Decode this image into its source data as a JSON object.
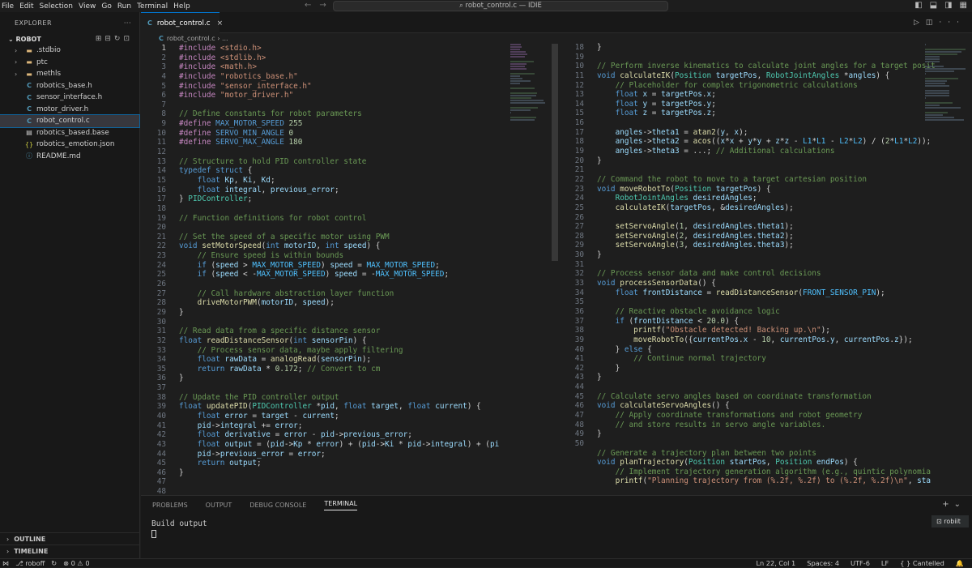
{
  "menu": [
    "File",
    "Edit",
    "Selection",
    "View",
    "Go",
    "Run",
    "Terminal",
    "Help"
  ],
  "command_center": "robot_control.c — IDIE",
  "sidebar": {
    "header": "EXPLORER",
    "root": "ROBOT",
    "items": [
      {
        "label": ".stdbio",
        "kind": "folder"
      },
      {
        "label": "ptc",
        "kind": "folder"
      },
      {
        "label": "methls",
        "kind": "folder"
      },
      {
        "label": "robotics_base.h",
        "kind": "c"
      },
      {
        "label": "sensor_interface.h",
        "kind": "c"
      },
      {
        "label": "motor_driver.h",
        "kind": "c"
      },
      {
        "label": "robot_control.c",
        "kind": "c",
        "selected": true
      },
      {
        "label": "robotics_based.base",
        "kind": "file"
      },
      {
        "label": "robotics_emotion.json",
        "kind": "json"
      },
      {
        "label": "README.md",
        "kind": "info"
      }
    ],
    "outline": "OUTLINE",
    "timeline": "TIMELINE"
  },
  "tab": {
    "label": "robot_control.c"
  },
  "breadcrumb": {
    "file": "robot_control.c",
    "more": "..."
  },
  "panel": {
    "tabs": [
      "PROBLEMS",
      "OUTPUT",
      "DEBUG CONSOLE",
      "TERMINAL"
    ],
    "active_tab": "TERMINAL",
    "output": "Build output",
    "terminal_name": "robiit"
  },
  "status": {
    "branch": "roboff",
    "problems": "0 ⚠ 0",
    "position": "Ln 22, Col 1",
    "spaces": "Spaces: 4",
    "encoding": "UTF-6",
    "eol": "LF",
    "status": "Cantelled"
  },
  "editor_left": {
    "start_line": 1,
    "current_line": 1,
    "lines": [
      "#include <stdio.h>",
      "#include <stdlib.h>",
      "#include <math.h>",
      "#include \"robotics_base.h\"",
      "#include \"sensor_interface.h\"",
      "#include \"motor_driver.h\"",
      "",
      "// Define constants for robot parameters",
      "#define MAX_MOTOR_SPEED 255",
      "#define SERVO_MIN_ANGLE 0",
      "#define SERVO_MAX_ANGLE 180",
      "",
      "// Structure to hold PID controller state",
      "typedef struct {",
      "    float Kp, Ki, Kd;",
      "    float integral, previous_error;",
      "} PIDController;",
      "",
      "// Function definitions for robot control",
      "",
      "// Set the speed of a specific motor using PWM",
      "void setMotorSpeed(int motorID, int speed) {",
      "    // Ensure speed is within bounds",
      "    if (speed > MAX_MOTOR_SPEED) speed = MAX_MOTOR_SPEED;",
      "    if (speed < -MAX_MOTOR_SPEED) speed = -MAX_MOTOR_SPEED;",
      "",
      "    // Call hardware abstraction layer function",
      "    driveMotorPWM(motorID, speed);",
      "}",
      "",
      "// Read data from a specific distance sensor",
      "float readDistanceSensor(int sensorPin) {",
      "    // Process sensor data, maybe apply filtering",
      "    float rawData = analogRead(sensorPin);",
      "    return rawData * 0.172; // Convert to cm",
      "}",
      "",
      "// Update the PID controller output",
      "float updatePID(PIDController *pid, float target, float current) {",
      "    float error = target - current;",
      "    pid->integral += error;",
      "    float derivative = error - pid->previous_error;",
      "    float output = (pid->Kp * error) + (pid->Ki * pid->integral) + (pi",
      "    pid->previous_error = error;",
      "    return output;",
      "}",
      "",
      ""
    ]
  },
  "editor_right": {
    "line_numbers": [
      "18",
      "19",
      "10",
      "11",
      "12",
      "13",
      "14",
      "15",
      "16",
      "17",
      "18",
      "19",
      "20",
      "21",
      "22",
      "23",
      "24",
      "25",
      "26",
      "27",
      "28",
      "29",
      "30",
      "31",
      "32",
      "33",
      "34",
      "35",
      "36",
      "37",
      "38",
      "39",
      "40",
      "41",
      "42",
      "43",
      "44",
      "45",
      "46",
      "47",
      "48",
      "49",
      "50"
    ],
    "lines": [
      "}",
      "",
      "// Perform inverse kinematics to calculate joint angles for a target posit",
      "void calculateIK(Position targetPos, RobotJointAngles *angles) {",
      "    // Placeholder for complex trigonometric calculations",
      "    float x = targetPos.x;",
      "    float y = targetPos.y;",
      "    float z = targetPos.z;",
      "",
      "    angles->theta1 = atan2(y, x);",
      "    angles->theta2 = acos((x*x + y*y + z*z - L1*L1 - L2*L2) / (2*L1*L2));",
      "    angles->theta3 = ...; // Additional calculations",
      "}",
      "",
      "// Command the robot to move to a target cartesian position",
      "void moveRobotTo(Position targetPos) {",
      "    RobotJointAngles desiredAngles;",
      "    calculateIK(targetPos, &desiredAngles);",
      "",
      "    setServoAngle(1, desiredAngles.theta1);",
      "    setServoAngle(2, desiredAngles.theta2);",
      "    setServoAngle(3, desiredAngles.theta3);",
      "}",
      "",
      "// Process sensor data and make control decisions",
      "void processSensorData() {",
      "    float frontDistance = readDistanceSensor(FRONT_SENSOR_PIN);",
      "",
      "    // Reactive obstacle avoidance logic",
      "    if (frontDistance < 20.0) {",
      "        printf(\"Obstacle detected! Backing up.\\n\");",
      "        moveRobotTo({currentPos.x - 10, currentPos.y, currentPos.z});",
      "    } else {",
      "        // Continue normal trajectory",
      "    }",
      "}",
      "",
      "// Calculate servo angles based on coordinate transformation",
      "void calculateServoAngles() {",
      "    // Apply coordinate transformations and robot geometry",
      "    // and store results in servo angle variables.",
      "}",
      "",
      "// Generate a trajectory plan between two points",
      "void planTrajectory(Position startPos, Position endPos) {",
      "    // Implement trajectory generation algorithm (e.g., quintic polynomia",
      "    printf(\"Planning trajectory from (%.2f, %.2f) to (%.2f, %.2f)\\n\", sta"
    ]
  },
  "colors": {
    "accent": "#0078d4",
    "background": "#1e1e1e",
    "sidebar": "#181818"
  }
}
